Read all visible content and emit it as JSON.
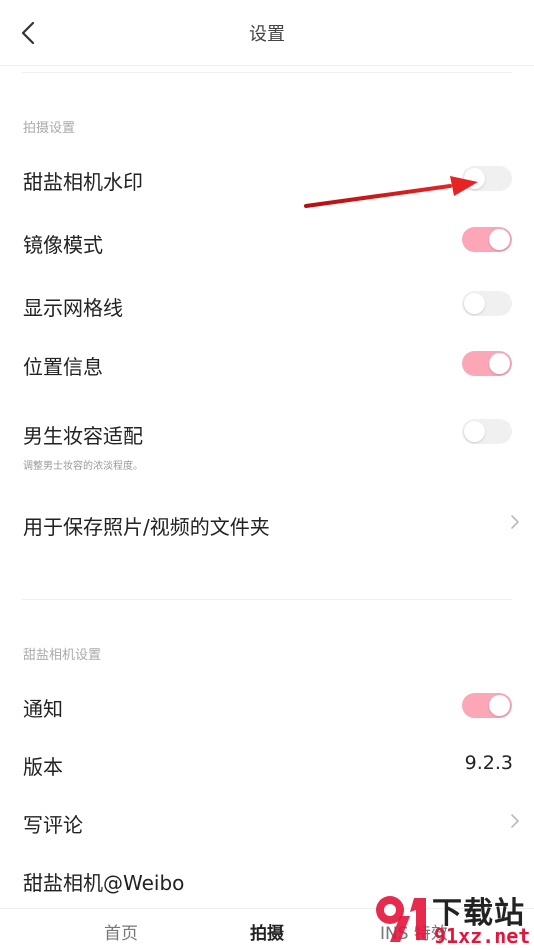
{
  "header": {
    "title": "设置"
  },
  "sections": {
    "shoot": {
      "title": "拍摄设置",
      "watermark": {
        "label": "甜盐相机水印",
        "on": false
      },
      "mirror": {
        "label": "镜像模式",
        "on": true
      },
      "grid": {
        "label": "显示网格线",
        "on": false
      },
      "location": {
        "label": "位置信息",
        "on": true
      },
      "male_makeup": {
        "label": "男生妆容适配",
        "sub": "调整男士妆容的浓淡程度。",
        "on": false
      },
      "save_folder": {
        "label": "用于保存照片/视频的文件夹"
      }
    },
    "app": {
      "title": "甜盐相机设置",
      "notify": {
        "label": "通知",
        "on": true
      },
      "version": {
        "label": "版本",
        "value": "9.2.3"
      },
      "review": {
        "label": "写评论"
      },
      "weibo": {
        "label": "甜盐相机@Weibo"
      }
    }
  },
  "tabbar": {
    "home": "首页",
    "shoot": "拍摄",
    "ins": "INS 特效"
  },
  "watermark_overlay": {
    "text": "下载站",
    "url": "91xz.net"
  },
  "colors": {
    "toggle_on": "#fba7b8",
    "toggle_off": "#f0f0f0",
    "arrow": "#d81e1e",
    "brand_red": "#e2153c"
  }
}
